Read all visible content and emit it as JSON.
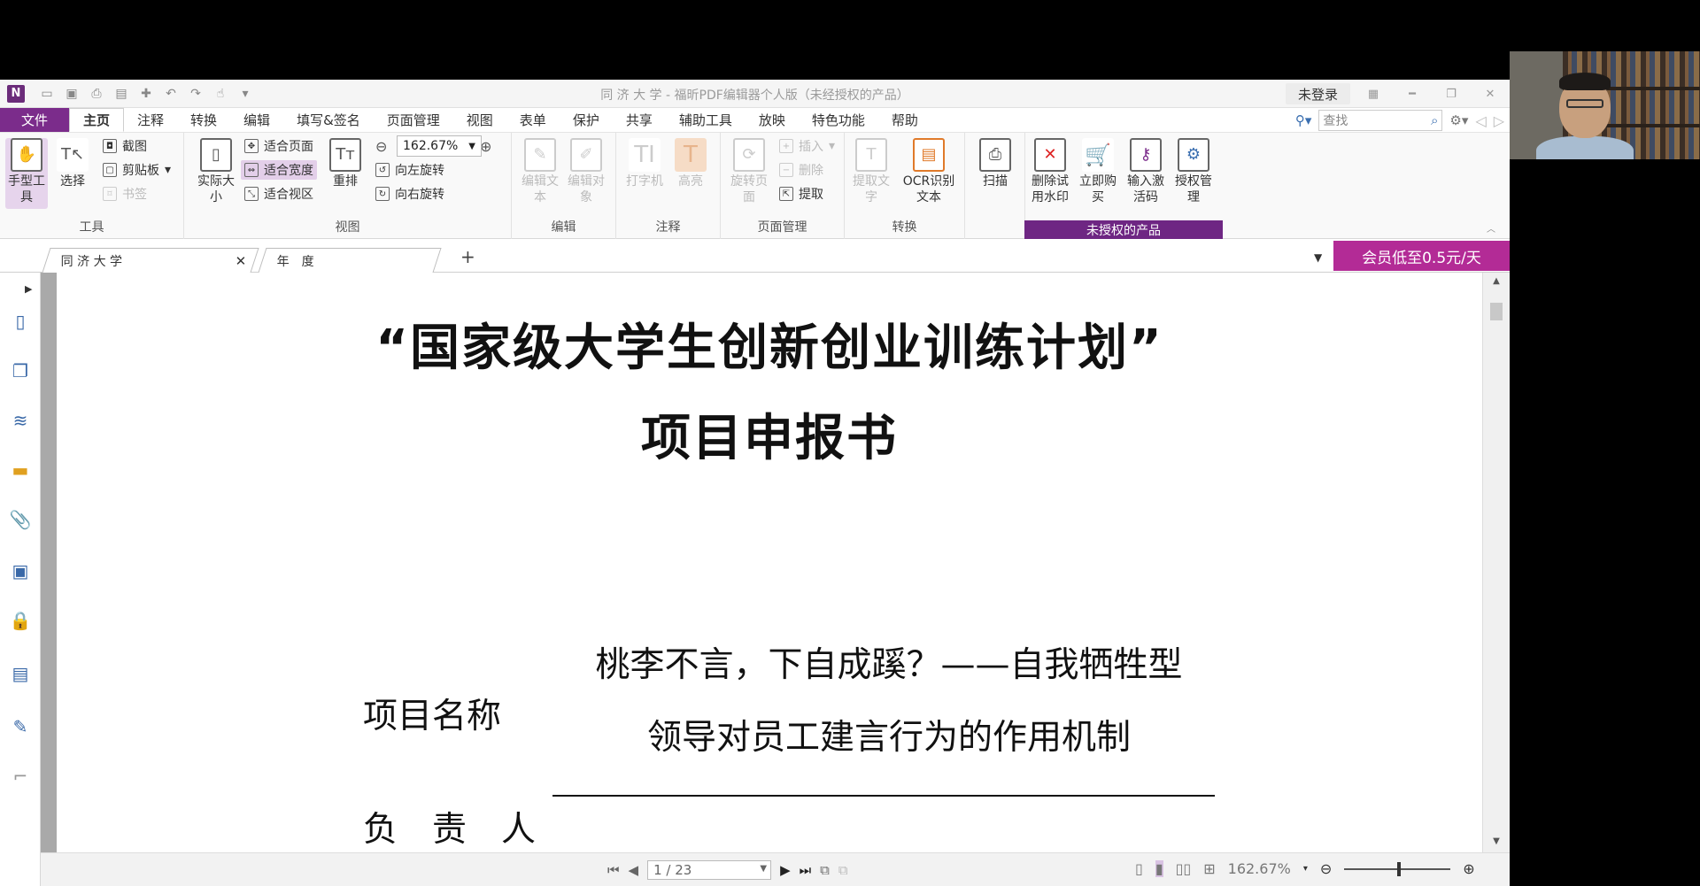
{
  "window": {
    "title": "同 济 大 学 - 福昕PDF编辑器个人版（未经授权的产品）",
    "login": "未登录"
  },
  "menu": {
    "file": "文件",
    "tabs": [
      "主页",
      "注释",
      "转换",
      "编辑",
      "填写&签名",
      "页面管理",
      "视图",
      "表单",
      "保护",
      "共享",
      "辅助工具",
      "放映",
      "特色功能",
      "帮助"
    ],
    "search_placeholder": "查找"
  },
  "ribbon": {
    "tools": {
      "hand": "手型工具",
      "select": "选择",
      "screenshot": "截图",
      "clipboard": "剪贴板",
      "bookmark": "书签",
      "label": "工具"
    },
    "view": {
      "actual_size": "实际大小",
      "fit_page": "适合页面",
      "fit_width": "适合宽度",
      "fit_view": "适合视区",
      "reflow": "重排",
      "zoom": "162.67%",
      "rotate_left": "向左旋转",
      "rotate_right": "向右旋转",
      "label": "视图"
    },
    "edit": {
      "edit_text": "编辑文本",
      "edit_object": "编辑对象",
      "label": "编辑"
    },
    "annot": {
      "typewriter": "打字机",
      "highlight": "高亮",
      "label": "注释"
    },
    "pages": {
      "rotate_page": "旋转页面",
      "insert": "插入",
      "delete": "删除",
      "extract": "提取",
      "label": "页面管理"
    },
    "convert": {
      "extract_text": "提取文字",
      "ocr": "OCR识别文本",
      "label": "转换"
    },
    "scan": "扫描",
    "unauth": {
      "remove_watermark": "删除试用水印",
      "buy_now": "立即购买",
      "enter_code": "输入激活码",
      "license_mgmt": "授权管理",
      "band": "未授权的产品"
    }
  },
  "doctabs": {
    "tab1": "同 济 大 学",
    "tab2": "年　度",
    "add": "+",
    "promo": "会员低至0.5元/天"
  },
  "document": {
    "title": "“国家级大学生创新创业训练计划”",
    "subtitle": "项目申报书",
    "project_name_label": "项目名称",
    "project_name_line1": "桃李不言，下自成蹊？——自我牺牲型",
    "project_name_line2": "领导对员工建言行为的作用机制",
    "leader_label": "负　责　人"
  },
  "status": {
    "page": "1 / 23",
    "zoom": "162.67%"
  }
}
